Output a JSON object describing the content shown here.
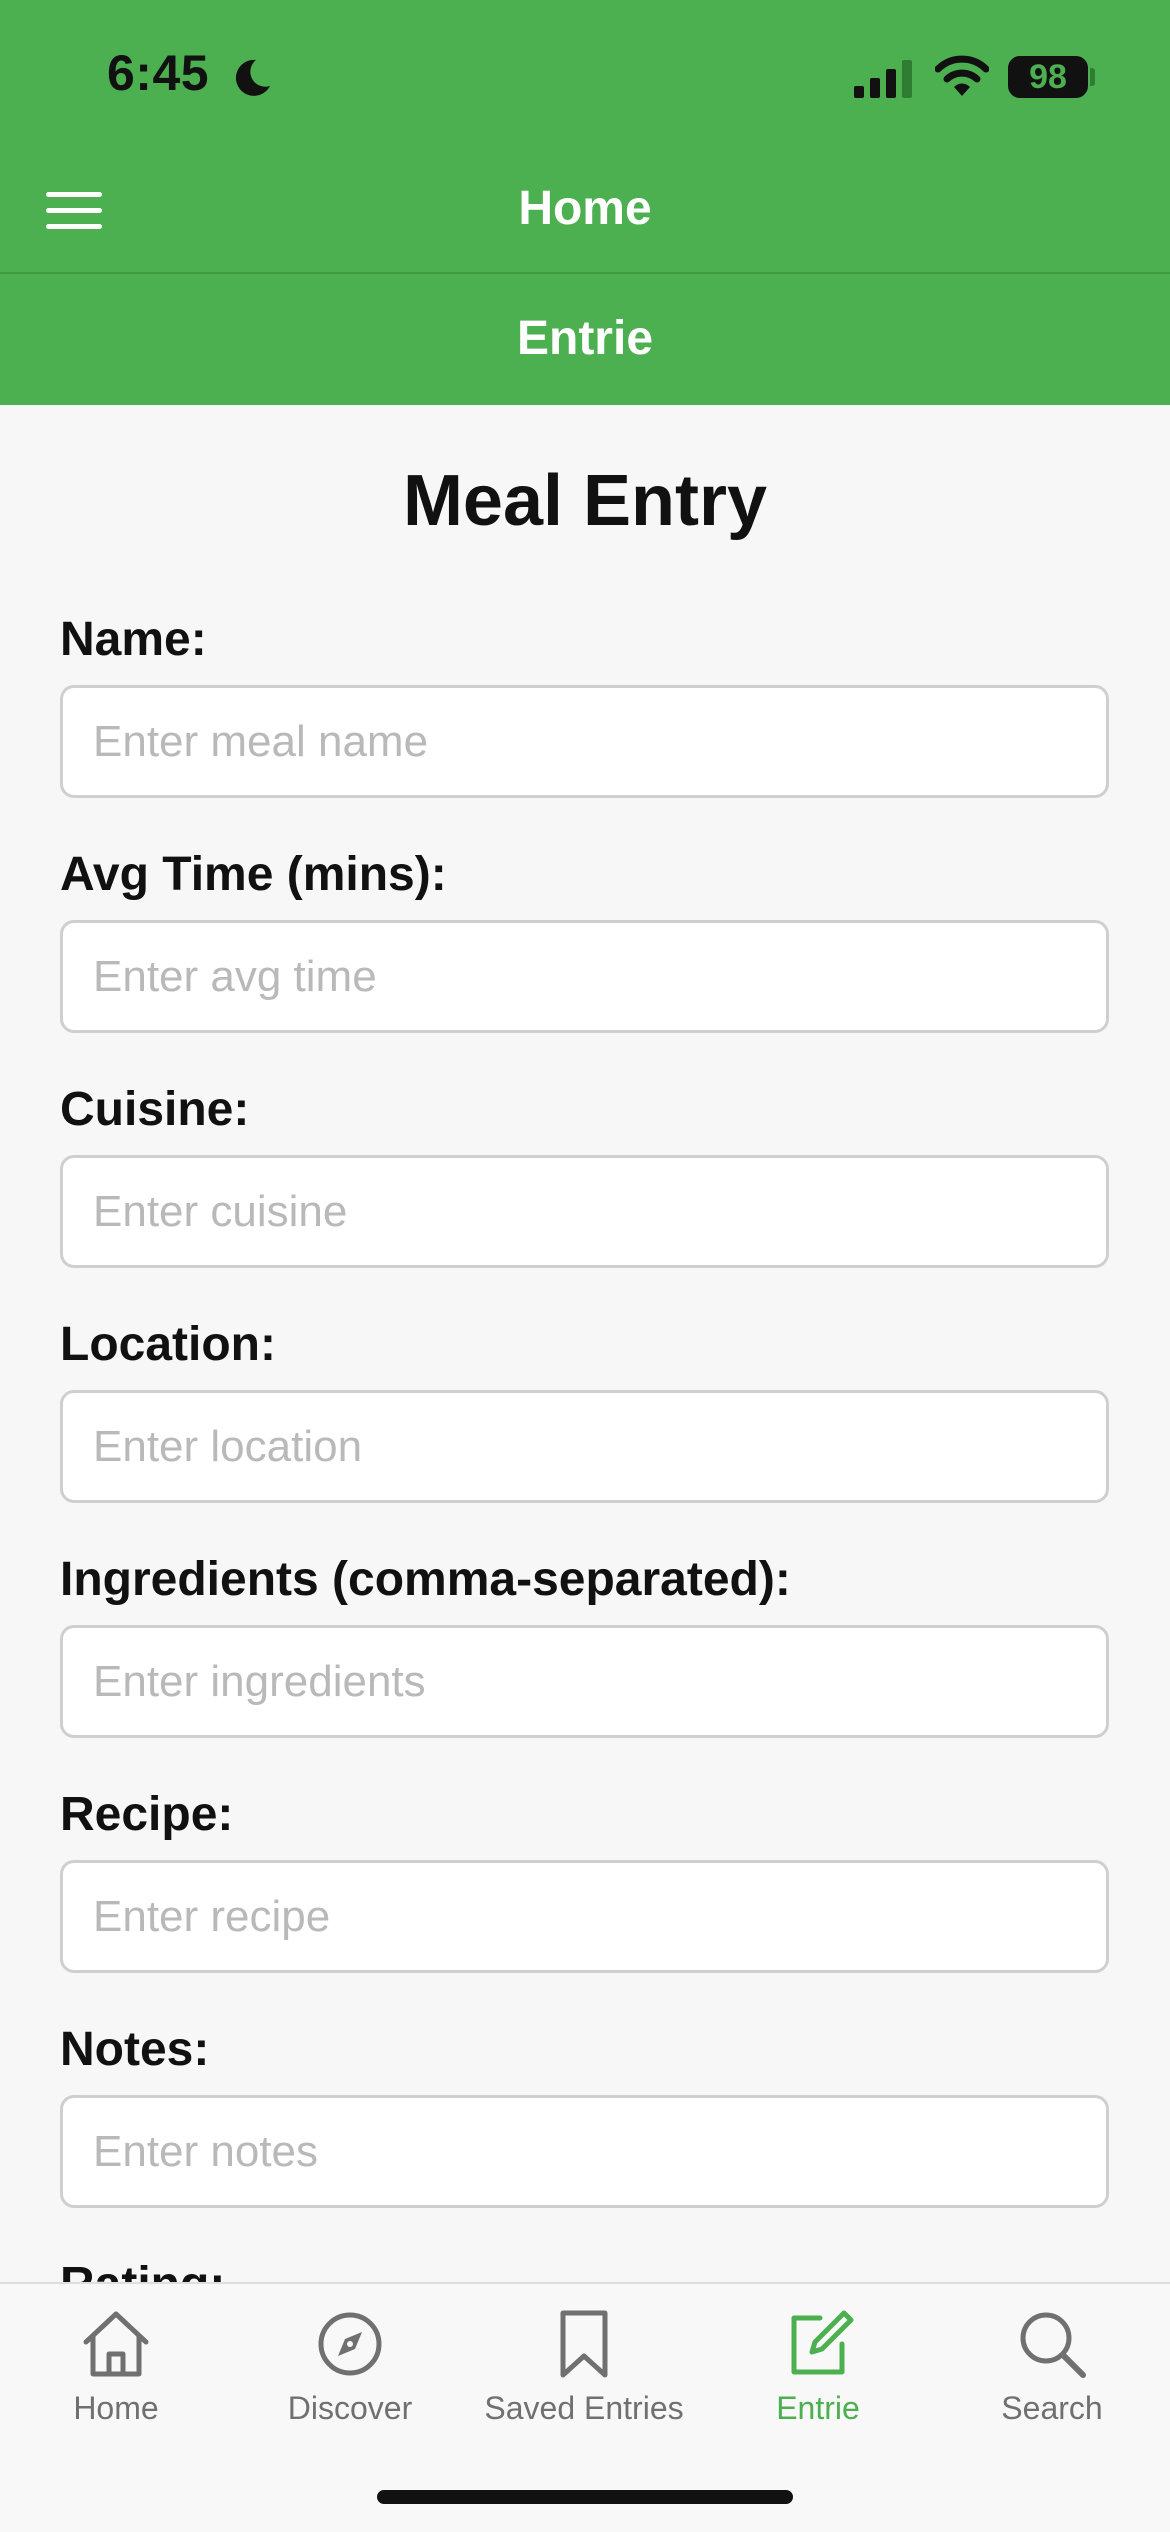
{
  "status_bar": {
    "time": "6:45",
    "battery": "98"
  },
  "nav": {
    "title": "Home"
  },
  "sub_header": {
    "title": "Entrie"
  },
  "form": {
    "title": "Meal Entry",
    "fields": [
      {
        "label": "Name:",
        "placeholder": "Enter meal name"
      },
      {
        "label": "Avg Time (mins):",
        "placeholder": "Enter avg time"
      },
      {
        "label": "Cuisine:",
        "placeholder": "Enter cuisine"
      },
      {
        "label": "Location:",
        "placeholder": "Enter location"
      },
      {
        "label": "Ingredients (comma-separated):",
        "placeholder": "Enter ingredients"
      },
      {
        "label": "Recipe:",
        "placeholder": "Enter recipe"
      },
      {
        "label": "Notes:",
        "placeholder": "Enter notes"
      },
      {
        "label": "Rating:"
      }
    ]
  },
  "tab_bar": {
    "tabs": [
      {
        "label": "Home",
        "icon": "home-icon"
      },
      {
        "label": "Discover",
        "icon": "compass-icon"
      },
      {
        "label": "Saved Entries",
        "icon": "bookmark-icon"
      },
      {
        "label": "Entrie",
        "icon": "edit-icon"
      },
      {
        "label": "Search",
        "icon": "search-icon"
      }
    ],
    "active_index": 3
  },
  "colors": {
    "accent": "#4caf50",
    "inactive_tab": "#707070",
    "placeholder": "#b9b9b9"
  }
}
